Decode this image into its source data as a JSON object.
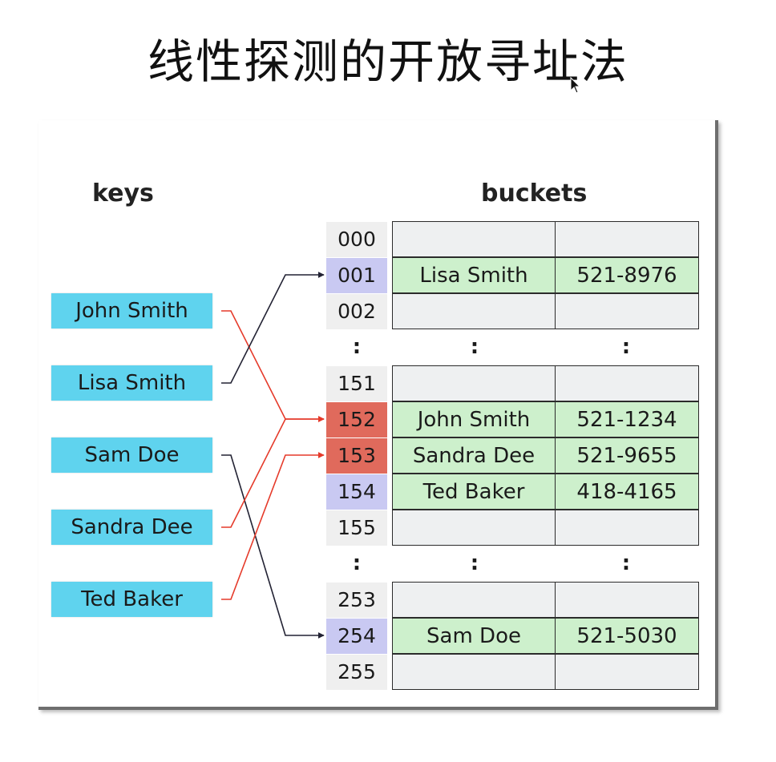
{
  "title": "线性探测的开放寻址法",
  "keys_heading": "keys",
  "buckets_heading": "buckets",
  "keys": [
    "John Smith",
    "Lisa Smith",
    "Sam Doe",
    "Sandra Dee",
    "Ted Baker"
  ],
  "buckets": [
    {
      "index": "000",
      "name": "",
      "phone": "",
      "index_color": "gray"
    },
    {
      "index": "001",
      "name": "Lisa Smith",
      "phone": "521-8976",
      "index_color": "blue"
    },
    {
      "index": "002",
      "name": "",
      "phone": "",
      "index_color": "gray"
    },
    {
      "index": "151",
      "name": "",
      "phone": "",
      "index_color": "gray"
    },
    {
      "index": "152",
      "name": "John Smith",
      "phone": "521-1234",
      "index_color": "red"
    },
    {
      "index": "153",
      "name": "Sandra Dee",
      "phone": "521-9655",
      "index_color": "red"
    },
    {
      "index": "154",
      "name": "Ted Baker",
      "phone": "418-4165",
      "index_color": "blue"
    },
    {
      "index": "155",
      "name": "",
      "phone": "",
      "index_color": "gray"
    },
    {
      "index": "253",
      "name": "",
      "phone": "",
      "index_color": "gray"
    },
    {
      "index": "254",
      "name": "Sam Doe",
      "phone": "521-5030",
      "index_color": "blue"
    },
    {
      "index": "255",
      "name": "",
      "phone": "",
      "index_color": "gray"
    }
  ],
  "ellipsis": ":",
  "colors": {
    "key_box": "#5fd3ee",
    "index_blue": "#c9c9f2",
    "index_red": "#e06a5c",
    "bucket_filled": "#cdf0cc",
    "bucket_empty": "#eef0f1",
    "collision_arrow": "#e53a2a",
    "normal_arrow": "#222233"
  },
  "mappings": [
    {
      "key": "John Smith",
      "bucket": "152",
      "collision": true
    },
    {
      "key": "Lisa Smith",
      "bucket": "001",
      "collision": false
    },
    {
      "key": "Sam Doe",
      "bucket": "254",
      "collision": false
    },
    {
      "key": "Sandra Dee",
      "bucket": "152",
      "collision": true
    },
    {
      "key": "Ted Baker",
      "bucket": "153",
      "collision": true
    }
  ]
}
